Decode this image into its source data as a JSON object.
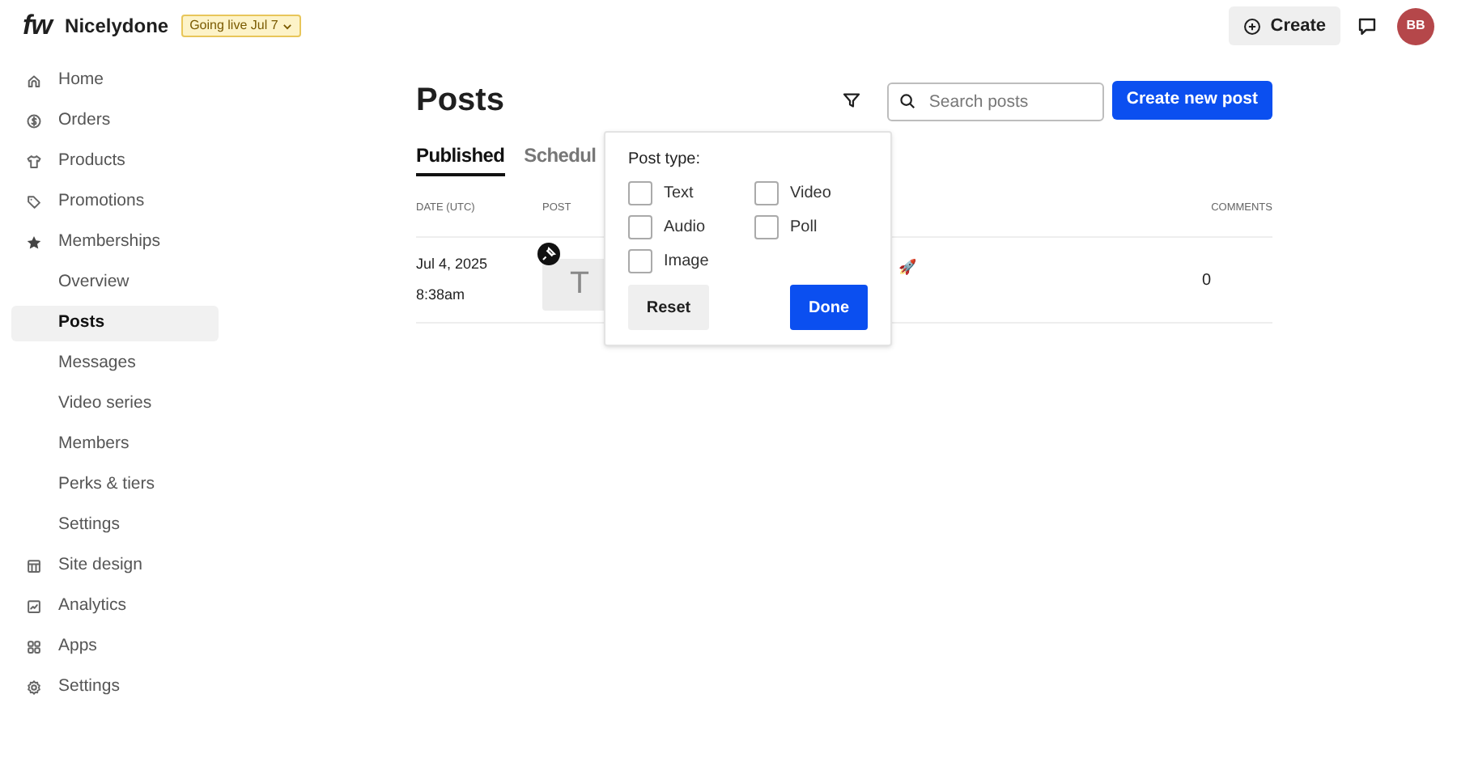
{
  "brand": {
    "logo": "fw",
    "name": "Nicelydone",
    "badge": "Going live Jul 7"
  },
  "header": {
    "create": "Create",
    "avatar": "BB"
  },
  "sidebar": {
    "items": [
      {
        "label": "Home",
        "kind": "home",
        "selected": false
      },
      {
        "label": "Orders",
        "kind": "dollar",
        "selected": false
      },
      {
        "label": "Products",
        "kind": "shirt",
        "selected": false
      },
      {
        "label": "Promotions",
        "kind": "tag",
        "selected": false
      },
      {
        "label": "Memberships",
        "kind": "star",
        "selected": false,
        "children": [
          {
            "label": "Overview",
            "selected": false
          },
          {
            "label": "Posts",
            "selected": true
          },
          {
            "label": "Messages",
            "selected": false
          },
          {
            "label": "Video series",
            "selected": false
          },
          {
            "label": "Members",
            "selected": false
          },
          {
            "label": "Perks & tiers",
            "selected": false
          },
          {
            "label": "Settings",
            "selected": false
          }
        ]
      },
      {
        "label": "Site design",
        "kind": "layout",
        "selected": false
      },
      {
        "label": "Analytics",
        "kind": "chart",
        "selected": false
      },
      {
        "label": "Apps",
        "kind": "apps",
        "selected": false
      },
      {
        "label": "Settings",
        "kind": "gear",
        "selected": false
      }
    ]
  },
  "page": {
    "title": "Posts",
    "search": {
      "placeholder": "Search posts"
    },
    "new_button": "Create new post"
  },
  "tabs": [
    {
      "label": "Published",
      "selected": true
    },
    {
      "label": "Schedul",
      "selected": false
    }
  ],
  "table": {
    "columns": [
      "DATE (UTC)",
      "POST",
      "COMMENTS"
    ],
    "rows": [
      {
        "date": "Jul 4, 2025",
        "time": "8:38am",
        "pinned": true,
        "thumb": "T",
        "title_tail": "🚀",
        "comments": "0"
      }
    ]
  },
  "popover": {
    "title": "Post type:",
    "options": [
      {
        "label": "Text",
        "checked": false
      },
      {
        "label": "Video",
        "checked": false
      },
      {
        "label": "Audio",
        "checked": false
      },
      {
        "label": "Poll",
        "checked": false
      },
      {
        "label": "Image",
        "checked": false
      }
    ],
    "reset": "Reset",
    "done": "Done"
  }
}
